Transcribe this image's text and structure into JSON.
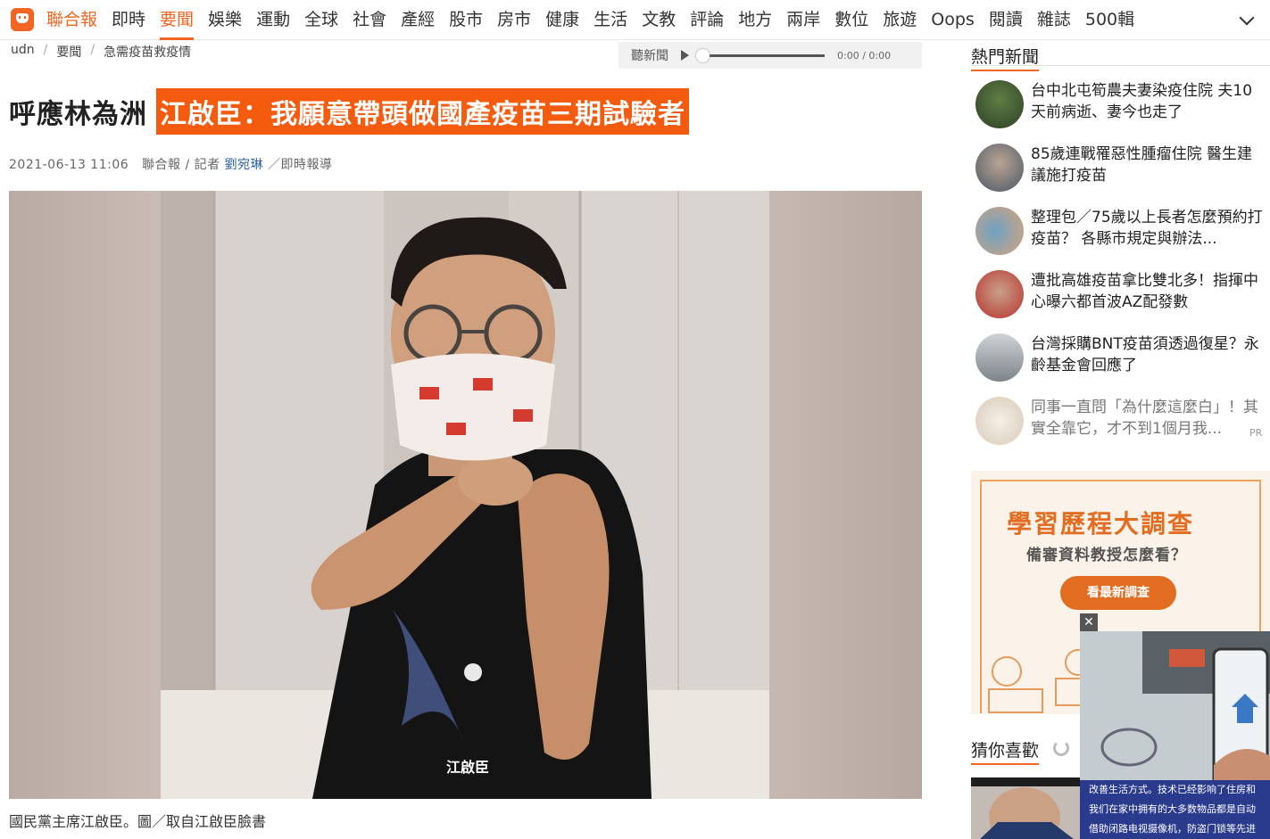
{
  "nav": {
    "brand": "聯合報",
    "items": [
      "即時",
      "要聞",
      "娛樂",
      "運動",
      "全球",
      "社會",
      "產經",
      "股市",
      "房市",
      "健康",
      "生活",
      "文教",
      "評論",
      "地方",
      "兩岸",
      "數位",
      "旅遊",
      "Oops",
      "閱讀",
      "雜誌",
      "500輯"
    ],
    "active": "要聞"
  },
  "breadcrumb": [
    "udn",
    "要聞",
    "急需疫苗救疫情"
  ],
  "audio": {
    "label": "聽新聞",
    "time": "0:00 / 0:00"
  },
  "article": {
    "headline_prefix": "呼應林為洲",
    "headline_highlight": "江啟臣：我願意帶頭做國產疫苗三期試驗者",
    "date": "2021-06-13 11:06",
    "source": "聯合報 / 記者",
    "author": "劉宛琳",
    "source_suffix": "／即時報導",
    "caption": "國民黨主席江啟臣。圖／取自江啟臣臉書",
    "shirt_text": "江啟臣"
  },
  "sidebar": {
    "hot_title": "熱門新聞",
    "news": [
      "台中北屯筍農夫妻染疫住院 夫10天前病逝、妻今也走了",
      "85歲連戰罹惡性腫瘤住院 醫生建議施打疫苗",
      "整理包／75歲以上長者怎麼預約打疫苗？ 各縣市規定與辦法...",
      "遭批高雄疫苗拿比雙北多！指揮中心曝六都首波AZ配發數",
      "台灣採購BNT疫苗須透過復星？永齡基金會回應了",
      "同事一直問「為什麼這麼白」！其實全靠它，才不到1個月我..."
    ],
    "pr_label": "PR",
    "ad": {
      "title": "學習歷程大調查",
      "subtitle": "備審資料教授怎麼看？",
      "button": "看最新調查"
    },
    "guess_title": "猜你喜歡"
  },
  "video": {
    "close": "✕",
    "captions": [
      "改善生活方式。技术已经影响了住房和",
      "我们在家中拥有的大多数物品都是自动",
      "借助闭路电视摄像机，防盗门锁等先进"
    ]
  },
  "colors": {
    "accent": "#f26522",
    "highlight": "#f45b0e"
  }
}
